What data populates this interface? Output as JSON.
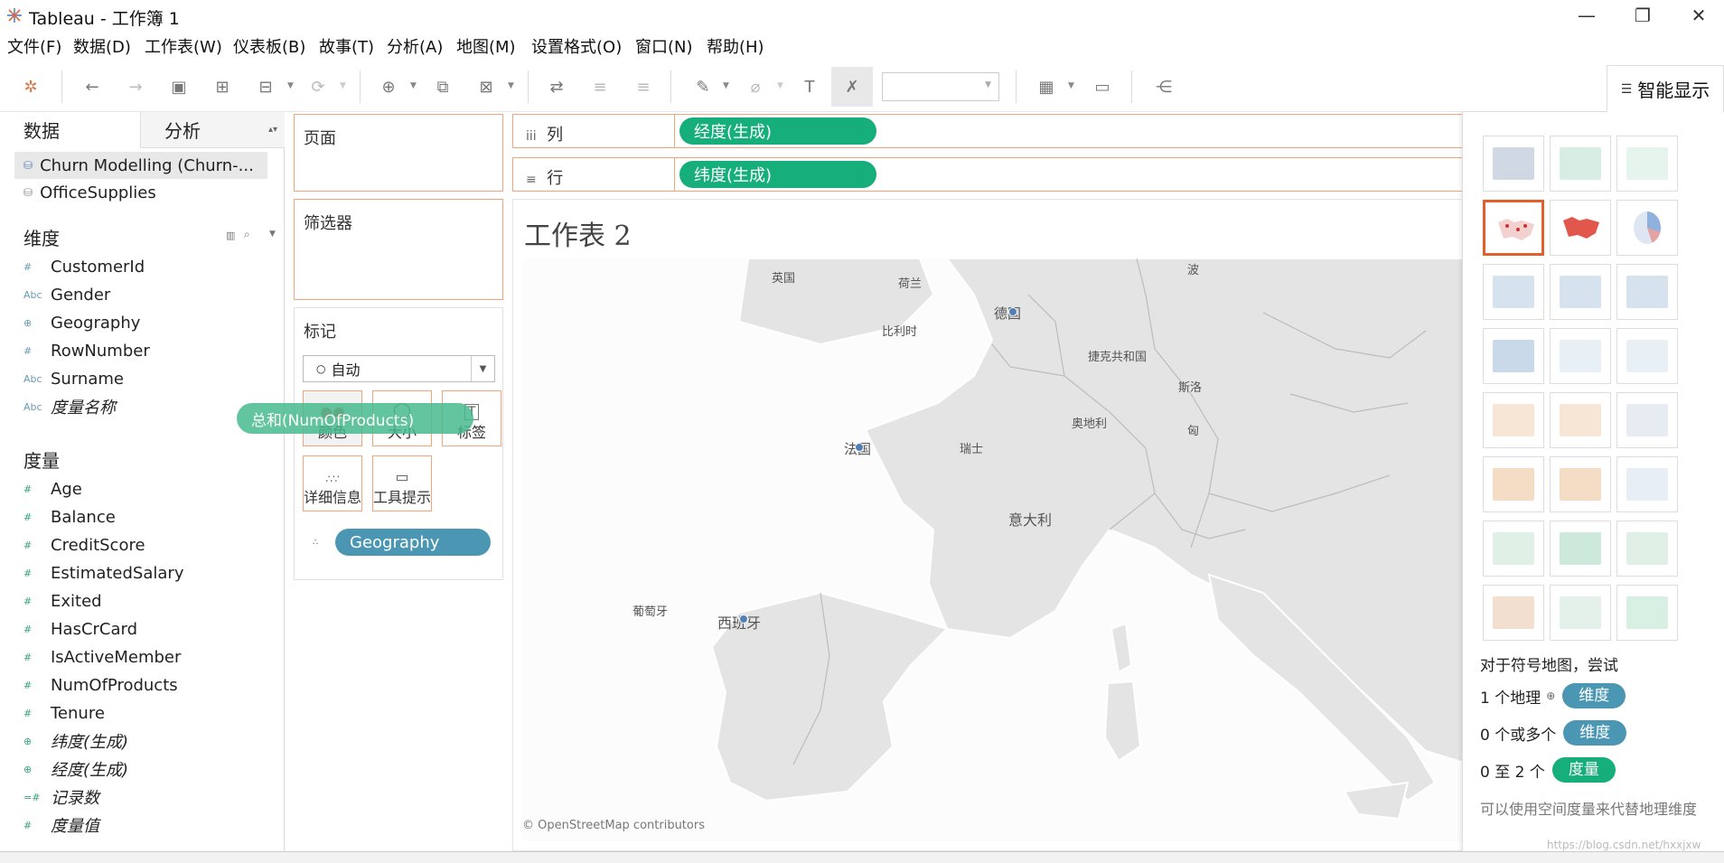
{
  "window": {
    "title": "Tableau - 工作簿 1"
  },
  "menu": [
    "文件(F)",
    "数据(D)",
    "工作表(W)",
    "仪表板(B)",
    "故事(T)",
    "分析(A)",
    "地图(M)",
    "设置格式(O)",
    "窗口(N)",
    "帮助(H)"
  ],
  "left_panel": {
    "tabs": [
      "数据",
      "分析"
    ],
    "datasources": [
      "Churn Modelling (Churn-...",
      "OfficeSupplies"
    ],
    "dimensions_header": "维度",
    "dimensions": [
      {
        "name": "CustomerId",
        "type": "#"
      },
      {
        "name": "Gender",
        "type": "Abc"
      },
      {
        "name": "Geography",
        "type": "⊕"
      },
      {
        "name": "RowNumber",
        "type": "#"
      },
      {
        "name": "Surname",
        "type": "Abc"
      },
      {
        "name": "度量名称",
        "type": "Abc"
      }
    ],
    "measures_header": "度量",
    "measures": [
      {
        "name": "Age",
        "type": "#"
      },
      {
        "name": "Balance",
        "type": "#"
      },
      {
        "name": "CreditScore",
        "type": "#"
      },
      {
        "name": "EstimatedSalary",
        "type": "#"
      },
      {
        "name": "Exited",
        "type": "#"
      },
      {
        "name": "HasCrCard",
        "type": "#"
      },
      {
        "name": "IsActiveMember",
        "type": "#"
      },
      {
        "name": "NumOfProducts",
        "type": "#"
      },
      {
        "name": "Tenure",
        "type": "#"
      },
      {
        "name": "纬度(生成)",
        "type": "⊕"
      },
      {
        "name": "经度(生成)",
        "type": "⊕"
      },
      {
        "name": "记录数",
        "type": "=#"
      },
      {
        "name": "度量值",
        "type": "#"
      }
    ]
  },
  "shelves": {
    "pages": "页面",
    "filters": "筛选器",
    "marks": "标记",
    "mark_type": "自动",
    "mark_buttons": [
      "颜色",
      "大小",
      "标签",
      "详细信息",
      "工具提示"
    ],
    "detail_pill": "Geography",
    "columns_label": "列",
    "columns_pill": "经度(生成)",
    "rows_label": "行",
    "rows_pill": "纬度(生成)"
  },
  "drag_pill": "总和(NumOfProducts)",
  "sheet": {
    "title": "工作表 2",
    "attribution": "© OpenStreetMap contributors",
    "map_labels": [
      "英国",
      "荷兰",
      "比利时",
      "德国",
      "捷克共和国",
      "斯洛",
      "法国",
      "瑞士",
      "奥地利",
      "意大利",
      "葡萄牙",
      "西班牙",
      "匈",
      "波"
    ]
  },
  "show_me": {
    "tab_label": "智能显示",
    "hint_title": "对于符号地图，尝试",
    "hint1_text": "1 个地理",
    "hint1_pill": "维度",
    "hint2_text": "0 个或多个",
    "hint2_pill": "维度",
    "hint3_text": "0 至 2 个",
    "hint3_pill": "度量",
    "note": "可以使用空间度量来代替地理维度"
  },
  "watermark": "https://blog.csdn.net/hxxjxw"
}
